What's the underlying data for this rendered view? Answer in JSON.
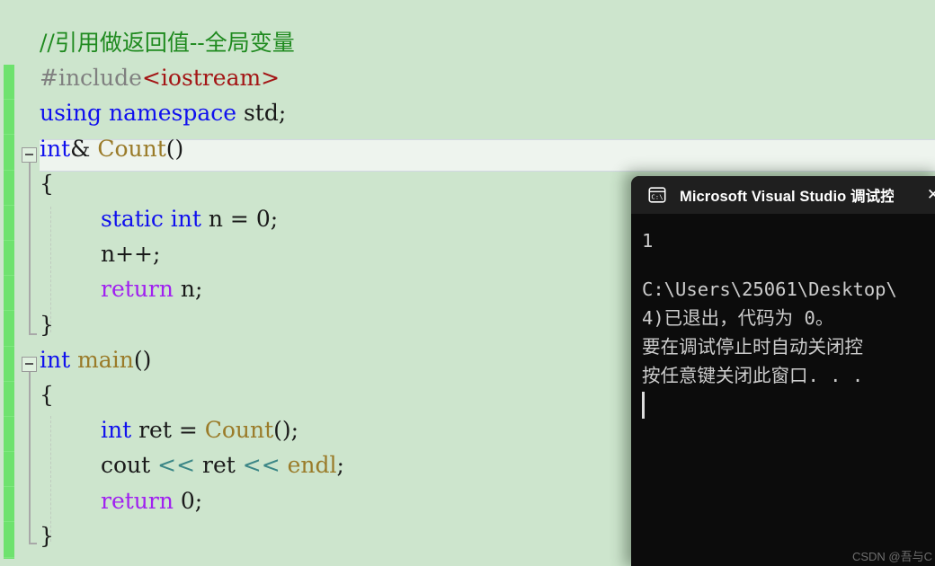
{
  "editor": {
    "background_color": "#cde5cd",
    "current_line_color": "#eef4ee",
    "change_bar_color": "#6ee26e",
    "lines": [
      {
        "indent": 0,
        "tokens": [
          {
            "text": "//引用做返回值--全局变量",
            "cls": "t-comment"
          }
        ]
      },
      {
        "indent": 0,
        "tokens": [
          {
            "text": "#include",
            "cls": "t-pp"
          },
          {
            "text": "<iostream>",
            "cls": "t-header"
          }
        ]
      },
      {
        "indent": 0,
        "tokens": [
          {
            "text": "using namespace ",
            "cls": "t-kw"
          },
          {
            "text": "std;",
            "cls": "t-plain"
          }
        ]
      },
      {
        "indent": 0,
        "tokens": [
          {
            "text": "int",
            "cls": "t-kw"
          },
          {
            "text": "& ",
            "cls": "t-plain"
          },
          {
            "text": "Count",
            "cls": "t-func"
          },
          {
            "text": "()",
            "cls": "t-plain"
          }
        ]
      },
      {
        "indent": 0,
        "tokens": [
          {
            "text": "{",
            "cls": "t-plain"
          }
        ]
      },
      {
        "indent": 1,
        "tokens": [
          {
            "text": "static int ",
            "cls": "t-kw"
          },
          {
            "text": "n = 0;",
            "cls": "t-plain"
          }
        ]
      },
      {
        "indent": 1,
        "tokens": [
          {
            "text": "n++;",
            "cls": "t-plain"
          }
        ]
      },
      {
        "indent": 1,
        "tokens": [
          {
            "text": "return",
            "cls": "t-ctrl"
          },
          {
            "text": " n;",
            "cls": "t-plain"
          }
        ]
      },
      {
        "indent": 0,
        "tokens": [
          {
            "text": "}",
            "cls": "t-plain"
          }
        ]
      },
      {
        "indent": 0,
        "tokens": [
          {
            "text": "int ",
            "cls": "t-kw"
          },
          {
            "text": "main",
            "cls": "t-func"
          },
          {
            "text": "()",
            "cls": "t-plain"
          }
        ]
      },
      {
        "indent": 0,
        "tokens": [
          {
            "text": "{",
            "cls": "t-plain"
          }
        ]
      },
      {
        "indent": 1,
        "tokens": [
          {
            "text": "int ",
            "cls": "t-kw"
          },
          {
            "text": "ret = ",
            "cls": "t-plain"
          },
          {
            "text": "Count",
            "cls": "t-func"
          },
          {
            "text": "();",
            "cls": "t-plain"
          }
        ]
      },
      {
        "indent": 1,
        "tokens": [
          {
            "text": "cout ",
            "cls": "t-plain"
          },
          {
            "text": "<< ",
            "cls": "t-op"
          },
          {
            "text": "ret ",
            "cls": "t-plain"
          },
          {
            "text": "<< ",
            "cls": "t-op"
          },
          {
            "text": "endl",
            "cls": "t-func"
          },
          {
            "text": ";",
            "cls": "t-plain"
          }
        ]
      },
      {
        "indent": 1,
        "tokens": [
          {
            "text": "return",
            "cls": "t-ctrl"
          },
          {
            "text": " 0;",
            "cls": "t-plain"
          }
        ]
      },
      {
        "indent": 0,
        "tokens": [
          {
            "text": "}",
            "cls": "t-plain"
          }
        ]
      }
    ],
    "fold_markers": [
      {
        "label": "collapse-count-function",
        "line": 3
      },
      {
        "label": "collapse-main-function",
        "line": 9
      }
    ]
  },
  "console": {
    "title": "Microsoft Visual Studio 调试控制台",
    "icon": "console-cmd-icon",
    "close_label": "✕",
    "background_color": "#0c0c0c",
    "titlebar_color": "#1f1f1f",
    "output_lines": [
      "1",
      "",
      "C:\\Users\\25061\\Desktop\\",
      "4)已退出，代码为 0。",
      "要在调试停止时自动关闭控",
      "按任意键关闭此窗口. . ."
    ]
  },
  "watermark": {
    "text": "CSDN @吾与C"
  }
}
